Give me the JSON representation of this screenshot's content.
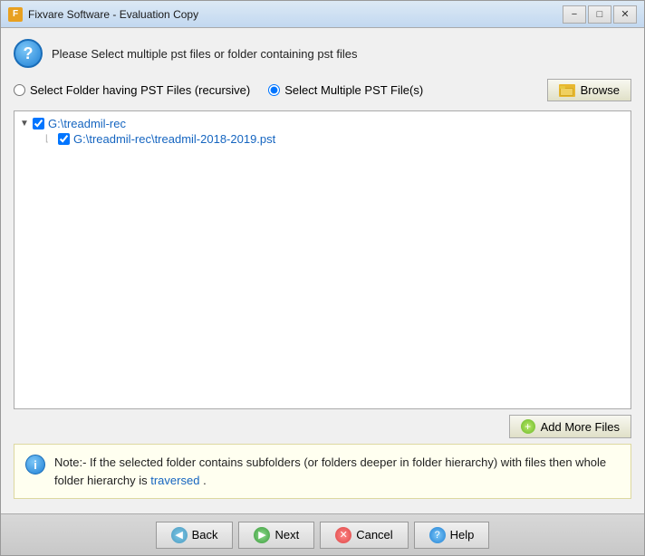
{
  "window": {
    "title": "Fixvare Software - Evaluation Copy",
    "icon_label": "F"
  },
  "header": {
    "message": "Please Select multiple pst files or folder containing pst files"
  },
  "options": {
    "folder_label": "Select Folder having PST Files (recursive)",
    "multiple_label": "Select Multiple PST File(s)",
    "browse_label": "Browse",
    "folder_selected": false,
    "multiple_selected": true
  },
  "tree": {
    "root": {
      "label": "G:\\treadmil-rec",
      "checked": true,
      "expanded": true
    },
    "children": [
      {
        "label": "G:\\treadmil-rec\\treadmil-2018-2019.pst",
        "checked": true
      }
    ]
  },
  "buttons": {
    "add_more_label": "Add More Files",
    "add_icon": "+"
  },
  "note": {
    "text_before": "Note:- If the selected folder contains subfolders (or folders deeper in folder hierarchy) with files then whole folder hierarchy is",
    "traversed": "traversed",
    "text_after": "."
  },
  "footer": {
    "back_label": "Back",
    "next_label": "Next",
    "cancel_label": "Cancel",
    "help_label": "Help"
  }
}
